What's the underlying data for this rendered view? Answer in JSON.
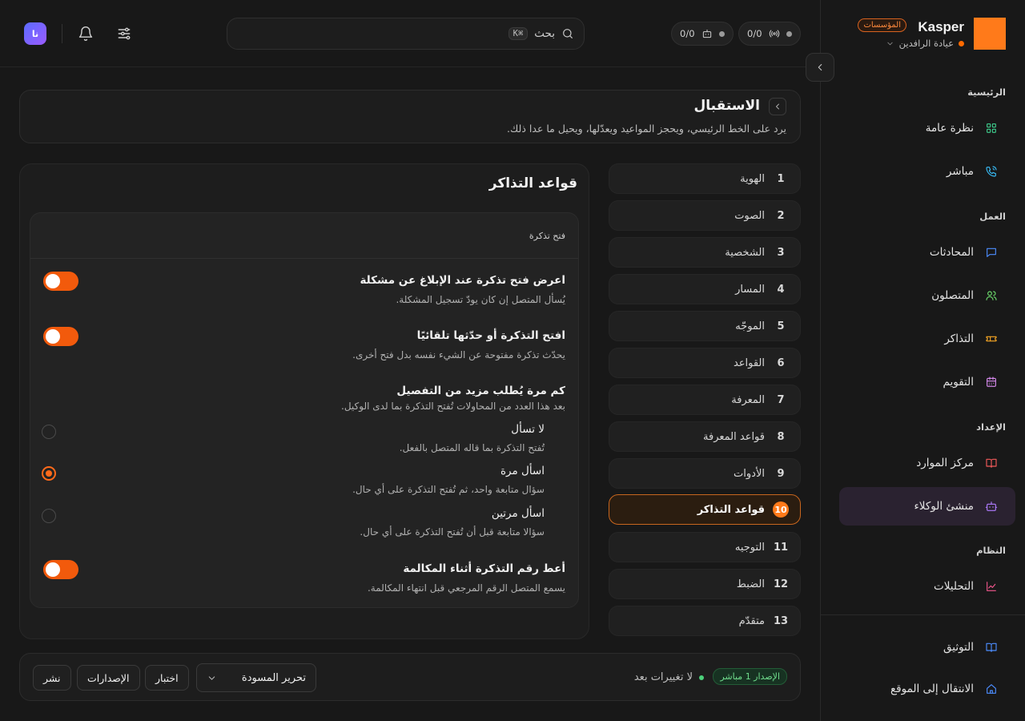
{
  "brand": {
    "name": "Kasper",
    "badge": "المؤسسات",
    "org": "عيادة الرافدين",
    "logo_color": "#ff7a1a"
  },
  "sidebar": {
    "sections": [
      {
        "label": "الرئيسية"
      },
      {
        "label": "العمل"
      },
      {
        "label": "الإعداد"
      },
      {
        "label": "النظام"
      }
    ],
    "items": [
      {
        "label": "نظرة عامة",
        "icon": "grid-icon",
        "color": "#3fcf8e"
      },
      {
        "label": "مباشر",
        "icon": "phone-call-icon",
        "color": "#38bdf8"
      },
      {
        "label": "المحادثات",
        "icon": "message-icon",
        "color": "#4c8dff"
      },
      {
        "label": "المتصلون",
        "icon": "users-icon",
        "color": "#6ee06e"
      },
      {
        "label": "التذاكر",
        "icon": "ticket-icon",
        "color": "#f5a524"
      },
      {
        "label": "التقويم",
        "icon": "calendar-icon",
        "color": "#d98cf0"
      },
      {
        "label": "مركز الموارد",
        "icon": "book-open-icon",
        "color": "#f25a5a"
      },
      {
        "label": "منشئ الوكلاء",
        "icon": "bot-icon",
        "color": "#b07cff",
        "active": true
      },
      {
        "label": "التحليلات",
        "icon": "chart-line-icon",
        "color": "#f0568c"
      }
    ],
    "footer": [
      {
        "label": "التوثيق",
        "icon": "book-icon",
        "color": "#4c8dff"
      },
      {
        "label": "الانتقال إلى الموقع",
        "icon": "home-icon",
        "color": "#4c8dff"
      }
    ]
  },
  "topbar": {
    "search_label": "بحث",
    "search_shortcut": "⌘K",
    "pill_live": "0/0",
    "pill_agents": "0/0",
    "avatar_initials": "نا"
  },
  "header": {
    "title": "الاستقبال",
    "subtitle": "يرد على الخط الرئيسي، ويحجز المواعيد ويعدّلها، ويحيل ما عدا ذلك."
  },
  "steps": [
    {
      "num": "1",
      "label": "الهوية"
    },
    {
      "num": "2",
      "label": "الصوت"
    },
    {
      "num": "3",
      "label": "الشخصية"
    },
    {
      "num": "4",
      "label": "المسار"
    },
    {
      "num": "5",
      "label": "الموجّه"
    },
    {
      "num": "6",
      "label": "القواعد"
    },
    {
      "num": "7",
      "label": "المعرفة"
    },
    {
      "num": "8",
      "label": "قواعد المعرفة"
    },
    {
      "num": "9",
      "label": "الأدوات"
    },
    {
      "num": "10",
      "label": "قواعد التذاكر",
      "active": true
    },
    {
      "num": "11",
      "label": "التوجيه"
    },
    {
      "num": "12",
      "label": "الضبط"
    },
    {
      "num": "13",
      "label": "متقدّم"
    }
  ],
  "panel": {
    "title": "قواعد التذاكر",
    "section_label": "فتح تذكرة",
    "options": [
      {
        "title": "اعرض فتح تذكرة عند الإبلاغ عن مشكلة",
        "desc": "يُسأل المتصل إن كان يودّ تسجيل المشكلة.",
        "enabled": true
      },
      {
        "title": "افتح التذكرة أو حدّثها تلقائيًا",
        "desc": "يحدّث تذكرة مفتوحة عن الشيء نفسه بدل فتح أخرى.",
        "enabled": true
      },
      {
        "title": "أعط رقم التذكرة أثناء المكالمة",
        "desc": "يسمع المتصل الرقم المرجعي قبل انتهاء المكالمة.",
        "enabled": true
      }
    ],
    "detail": {
      "title": "كم مرة يُطلب مزيد من التفصيل",
      "desc": "بعد هذا العدد من المحاولات تُفتح التذكرة بما لدى الوكيل.",
      "choices": [
        {
          "title": "لا تسأل",
          "desc": "تُفتح التذكرة بما قاله المتصل بالفعل.",
          "selected": false
        },
        {
          "title": "اسأل مرة",
          "desc": "سؤال متابعة واحد، ثم تُفتح التذكرة على أي حال.",
          "selected": true
        },
        {
          "title": "اسأل مرتين",
          "desc": "سؤالا متابعة قبل أن تُفتح التذكرة على أي حال.",
          "selected": false
        }
      ]
    }
  },
  "action_bar": {
    "version_badge": "الإصدار 1 مباشر",
    "status": "لا تغييرات بعد",
    "mode_select": "تحرير المسودة",
    "test_label": "اختبار",
    "versions_label": "الإصدارات",
    "publish_label": "نشر"
  },
  "colors": {
    "accent": "#ff6a1a",
    "toggle_on": "#f25a0c",
    "live_green": "#4cd07a"
  }
}
